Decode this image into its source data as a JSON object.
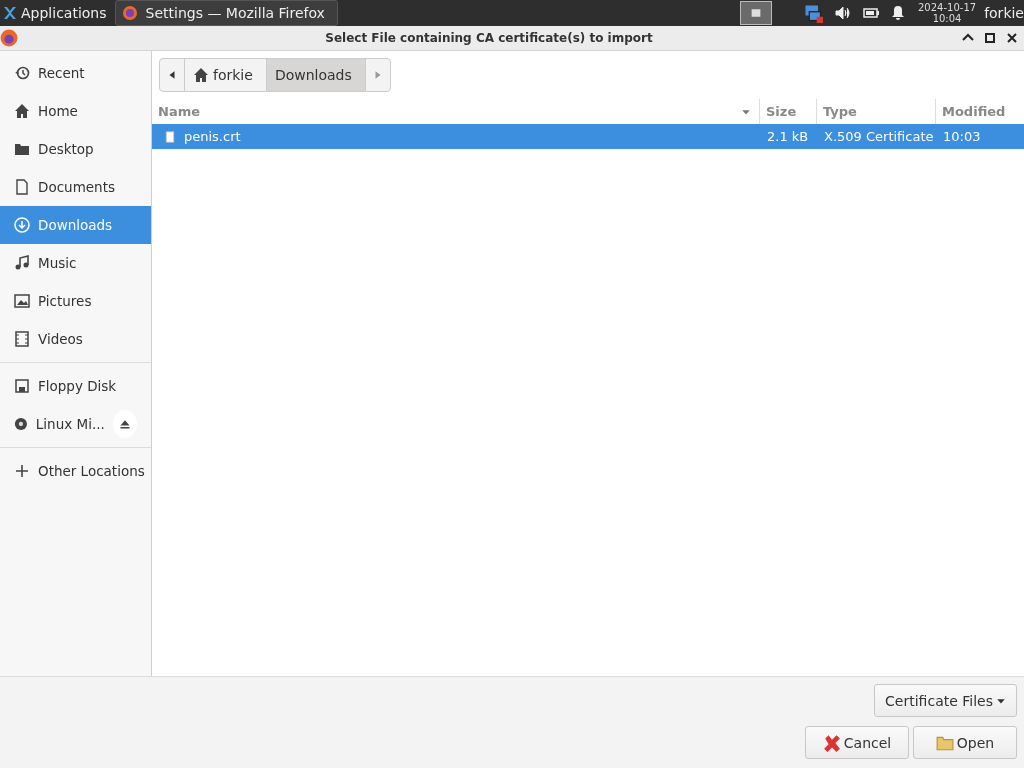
{
  "taskbar": {
    "apps_label": "Applications",
    "windows": [
      {
        "label": "Settings — Mozilla Firefox",
        "selected": true
      }
    ],
    "clock": {
      "date": "2024-10-17",
      "time": "10:04"
    },
    "user": "forkie"
  },
  "window": {
    "title": "Select File containing CA certificate(s) to import"
  },
  "sidebar": {
    "sections": [
      [
        {
          "label": "Recent",
          "kind": "place",
          "selected": false
        },
        {
          "label": "Home",
          "kind": "place",
          "selected": false
        },
        {
          "label": "Desktop",
          "kind": "place",
          "selected": false
        },
        {
          "label": "Documents",
          "kind": "place",
          "selected": false
        },
        {
          "label": "Downloads",
          "kind": "place",
          "selected": true
        },
        {
          "label": "Music",
          "kind": "place",
          "selected": false
        },
        {
          "label": "Pictures",
          "kind": "place",
          "selected": false
        },
        {
          "label": "Videos",
          "kind": "place",
          "selected": false
        }
      ],
      [
        {
          "label": "Floppy Disk",
          "kind": "place",
          "selected": false
        },
        {
          "label": "Linux Mi...",
          "kind": "mount",
          "selected": false
        }
      ],
      [
        {
          "label": "Other Locations",
          "kind": "place",
          "selected": false
        }
      ]
    ]
  },
  "path_bar": {
    "crumbs": [
      {
        "label": "forkie",
        "kind": "home",
        "selected": false
      },
      {
        "label": "Downloads",
        "kind": "folder",
        "selected": true
      }
    ]
  },
  "table": {
    "columns": [
      {
        "label": "Name",
        "sorted": true
      },
      {
        "label": "Size",
        "sorted": false
      },
      {
        "label": "Type",
        "sorted": false
      },
      {
        "label": "Modified",
        "sorted": false
      }
    ],
    "rows": [
      {
        "cells": [
          "penis.crt",
          "2.1 kB",
          "X.509 Certificate",
          "10:03"
        ],
        "selected": true
      }
    ]
  },
  "filter": {
    "label": "Certificate Files"
  },
  "buttons": [
    {
      "label": "Cancel",
      "kind": "cancel"
    },
    {
      "label": "Open",
      "kind": "open"
    }
  ]
}
